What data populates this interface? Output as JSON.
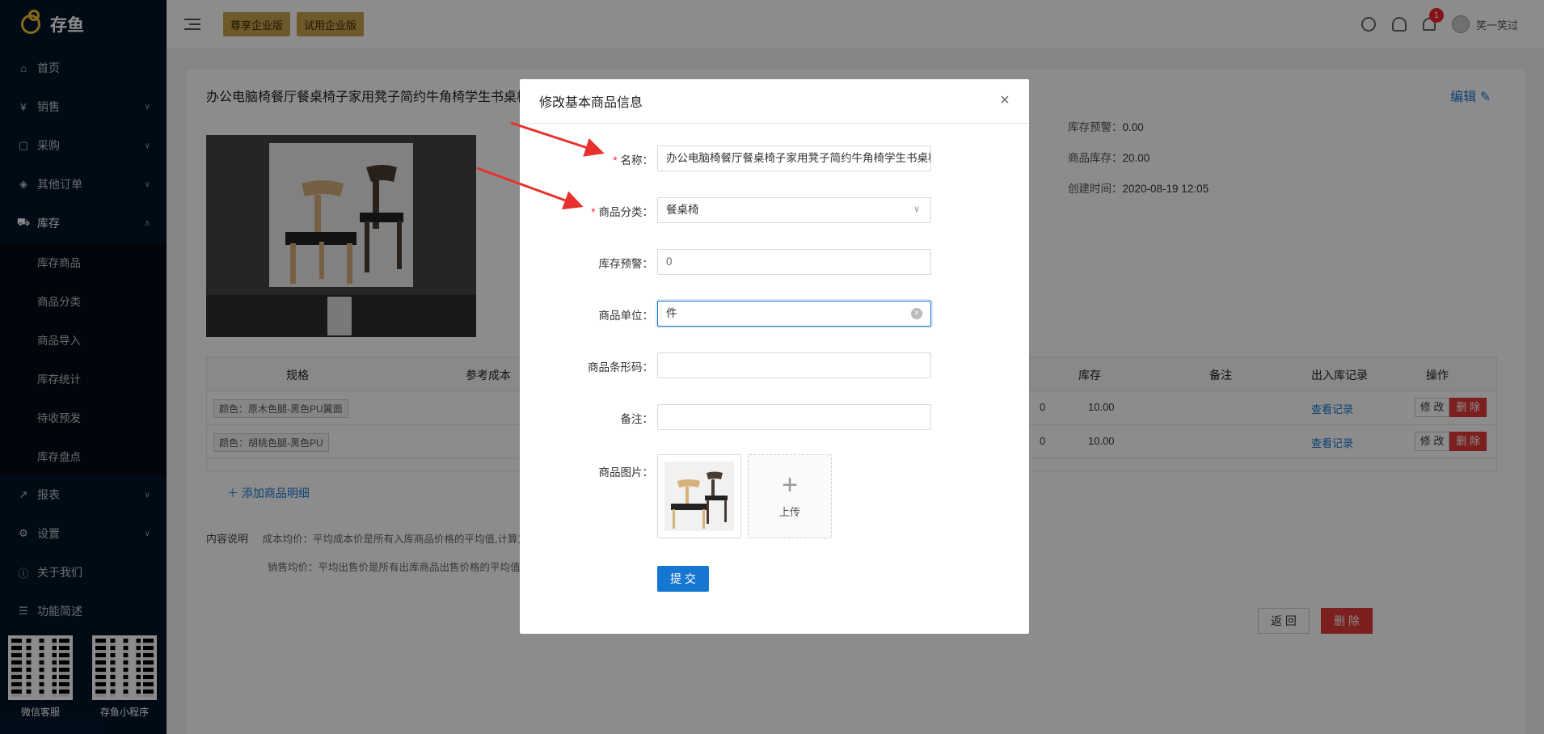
{
  "sidebar": {
    "logo": "存鱼",
    "items": [
      {
        "label": "首页",
        "icon": "home-icon",
        "glyph": "⌂"
      },
      {
        "label": "销售",
        "icon": "yen-icon",
        "glyph": "¥"
      },
      {
        "label": "采购",
        "icon": "bag-icon",
        "glyph": "▢"
      },
      {
        "label": "其他订单",
        "icon": "tag-icon",
        "glyph": "◈"
      },
      {
        "label": "库存",
        "icon": "cart-icon",
        "glyph": "⛟"
      }
    ],
    "submenu": [
      "库存商品",
      "商品分类",
      "商品导入",
      "库存统计",
      "待收预发",
      "库存盘点"
    ],
    "items_after": [
      {
        "label": "报表",
        "icon": "chart-icon",
        "glyph": "↗"
      },
      {
        "label": "设置",
        "icon": "gear-icon",
        "glyph": "⚙"
      },
      {
        "label": "关于我们",
        "icon": "info-icon",
        "glyph": "ⓘ"
      },
      {
        "label": "功能简述",
        "icon": "list-icon",
        "glyph": "☰"
      }
    ],
    "qr": [
      {
        "label": "微信客服"
      },
      {
        "label": "存鱼小程序"
      }
    ]
  },
  "header": {
    "badges": [
      "尊享企业版",
      "试用企业版"
    ],
    "notification_count": "1",
    "username": "笑一笑过"
  },
  "page": {
    "title": "办公电脑椅餐厅餐桌椅子家用凳子简约牛角椅学生书桌椅",
    "edit_label": "编辑",
    "info": [
      {
        "label": "库存预警：",
        "value": "0.00"
      },
      {
        "label": "商品库存：",
        "value": "20.00"
      },
      {
        "label": "创建时间：",
        "value": "2020-08-19 12:05"
      }
    ],
    "table": {
      "headers": {
        "spec": "规格",
        "ref_cost": "参考成本",
        "stock": "库存",
        "remark": "备注",
        "records": "出入库记录",
        "actions": "操作"
      },
      "rows": [
        {
          "spec": "颜色：原木色腿-黑色PU翼面",
          "stock": "10.00",
          "records": "查看记录",
          "edit": "修 改",
          "delete": "删 除",
          "partial": "0"
        },
        {
          "spec": "颜色：胡桃色腿-黑色PU",
          "stock": "10.00",
          "records": "查看记录",
          "edit": "修 改",
          "delete": "删 除",
          "partial": "0"
        }
      ]
    },
    "add_detail": "添加商品明细",
    "notes_title": "内容说明",
    "notes": [
      "成本均价：平均成本价是所有入库商品价格的平均值,计算方",
      "销售均价：平均出售价是所有出库商品出售价格的平均值"
    ],
    "back_label": "返 回",
    "delete_label": "删 除"
  },
  "modal": {
    "title": "修改基本商品信息",
    "fields": {
      "name": {
        "label": "名称",
        "value": "办公电脑椅餐厅餐桌椅子家用凳子简约牛角椅学生书桌椅",
        "required": true
      },
      "category": {
        "label": "商品分类",
        "value": "餐桌椅",
        "required": true
      },
      "stock_warning": {
        "label": "库存预警",
        "value": "0"
      },
      "unit": {
        "label": "商品单位",
        "value": "件"
      },
      "barcode": {
        "label": "商品条形码",
        "value": ""
      },
      "remark": {
        "label": "备注",
        "value": ""
      },
      "image": {
        "label": "商品图片"
      }
    },
    "upload_label": "上传",
    "submit_label": "提 交"
  },
  "colors": {
    "sidebar_bg": "#001529",
    "primary": "#1677d2",
    "danger": "#e03a3a",
    "gold": "#c9a24d",
    "arrow": "#e8312c"
  }
}
